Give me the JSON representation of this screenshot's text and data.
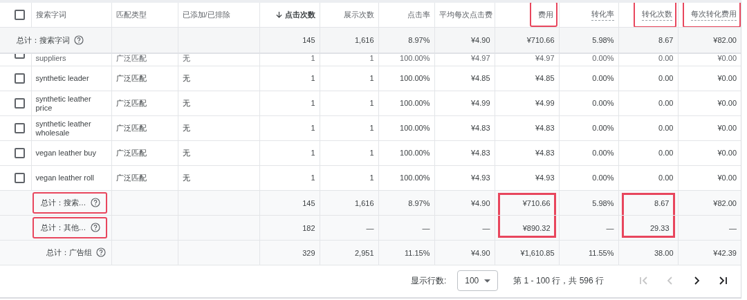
{
  "table": {
    "header_checkbox": {
      "checked": false
    },
    "columns": [
      {
        "label": "搜索字词",
        "sorted": false,
        "dotted": false,
        "highlighted": false
      },
      {
        "label": "匹配类型",
        "sorted": false,
        "dotted": false,
        "highlighted": false
      },
      {
        "label": "已添加/已排除",
        "sorted": false,
        "dotted": false,
        "highlighted": false
      },
      {
        "label": "点击次数",
        "sorted": true,
        "dotted": false,
        "highlighted": false
      },
      {
        "label": "展示次数",
        "sorted": false,
        "dotted": false,
        "highlighted": false
      },
      {
        "label": "点击率",
        "sorted": false,
        "dotted": false,
        "highlighted": false
      },
      {
        "label": "平均每次点击费",
        "sorted": false,
        "dotted": false,
        "highlighted": false
      },
      {
        "label": "费用",
        "sorted": false,
        "dotted": false,
        "highlighted": true
      },
      {
        "label": "转化率",
        "sorted": false,
        "dotted": true,
        "highlighted": false
      },
      {
        "label": "转化次数",
        "sorted": false,
        "dotted": true,
        "highlighted": true
      },
      {
        "label": "每次转化费用",
        "sorted": false,
        "dotted": true,
        "highlighted": true
      }
    ],
    "summary_row": {
      "label": "总计：搜索字词",
      "values": [
        "145",
        "1,616",
        "8.97%",
        "¥4.90",
        "¥710.66",
        "5.98%",
        "8.67",
        "¥82.00"
      ]
    },
    "rows": [
      {
        "checked": false,
        "partial": true,
        "cells": [
          "suppliers",
          "广泛匹配",
          "无",
          "1",
          "1",
          "100.00%",
          "¥4.97",
          "¥4.97",
          "0.00%",
          "0.00",
          "¥0.00"
        ]
      },
      {
        "checked": false,
        "partial": false,
        "cells": [
          "synthetic leader",
          "广泛匹配",
          "无",
          "1",
          "1",
          "100.00%",
          "¥4.85",
          "¥4.85",
          "0.00%",
          "0.00",
          "¥0.00"
        ]
      },
      {
        "checked": false,
        "partial": false,
        "cells": [
          "synthetic leather price",
          "广泛匹配",
          "无",
          "1",
          "1",
          "100.00%",
          "¥4.99",
          "¥4.99",
          "0.00%",
          "0.00",
          "¥0.00"
        ]
      },
      {
        "checked": false,
        "partial": false,
        "cells": [
          "synthetic leather wholesale",
          "广泛匹配",
          "无",
          "1",
          "1",
          "100.00%",
          "¥4.83",
          "¥4.83",
          "0.00%",
          "0.00",
          "¥0.00"
        ]
      },
      {
        "checked": false,
        "partial": false,
        "cells": [
          "vegan leather buy",
          "广泛匹配",
          "无",
          "1",
          "1",
          "100.00%",
          "¥4.83",
          "¥4.83",
          "0.00%",
          "0.00",
          "¥0.00"
        ]
      },
      {
        "checked": false,
        "partial": false,
        "cells": [
          "vegan leather roll",
          "广泛匹配",
          "无",
          "1",
          "1",
          "100.00%",
          "¥4.93",
          "¥4.93",
          "0.00%",
          "0.00",
          "¥0.00"
        ]
      }
    ],
    "totals": [
      {
        "label": "总计：搜索…",
        "label_highlighted": true,
        "values": [
          {
            "text": "145",
            "highlighted": false
          },
          {
            "text": "1,616",
            "highlighted": false
          },
          {
            "text": "8.97%",
            "highlighted": false
          },
          {
            "text": "¥4.90",
            "highlighted": false
          },
          {
            "text": "¥710.66",
            "highlighted": true
          },
          {
            "text": "5.98%",
            "highlighted": false
          },
          {
            "text": "8.67",
            "highlighted": true
          },
          {
            "text": "¥82.00",
            "highlighted": false
          }
        ]
      },
      {
        "label": "总计：其他…",
        "label_highlighted": true,
        "values": [
          {
            "text": "182",
            "highlighted": false
          },
          {
            "text": "—",
            "highlighted": false
          },
          {
            "text": "—",
            "highlighted": false
          },
          {
            "text": "—",
            "highlighted": false
          },
          {
            "text": "¥890.32",
            "highlighted": true
          },
          {
            "text": "—",
            "highlighted": false
          },
          {
            "text": "29.33",
            "highlighted": true
          },
          {
            "text": "—",
            "highlighted": false
          }
        ]
      },
      {
        "label": "总计：广告组",
        "label_highlighted": false,
        "values": [
          {
            "text": "329",
            "highlighted": false
          },
          {
            "text": "2,951",
            "highlighted": false
          },
          {
            "text": "11.15%",
            "highlighted": false
          },
          {
            "text": "¥4.90",
            "highlighted": false
          },
          {
            "text": "¥1,610.85",
            "highlighted": false
          },
          {
            "text": "11.55%",
            "highlighted": false
          },
          {
            "text": "38.00",
            "highlighted": false
          },
          {
            "text": "¥42.39",
            "highlighted": false
          }
        ]
      }
    ]
  },
  "pagination": {
    "rows_label": "显示行数:",
    "rows_per_page": "100",
    "range": "第 1 - 100 行，共 596 行",
    "buttons": [
      {
        "kind": "first",
        "disabled": true
      },
      {
        "kind": "prev",
        "disabled": true
      },
      {
        "kind": "next",
        "disabled": false
      },
      {
        "kind": "last",
        "disabled": false
      }
    ]
  }
}
